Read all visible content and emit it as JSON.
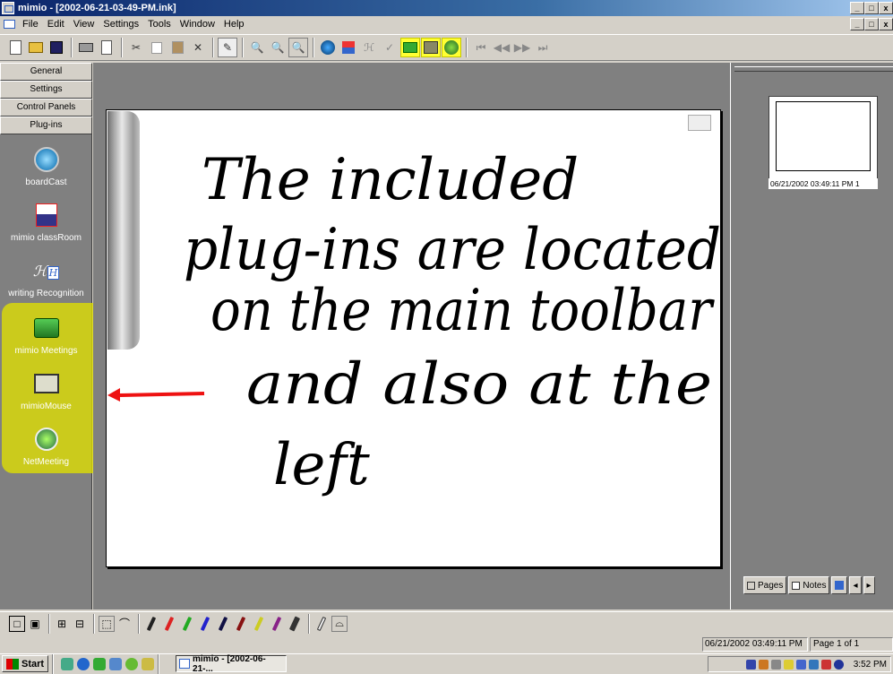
{
  "window": {
    "title": "mimio - [2002-06-21-03-49-PM.ink]",
    "controls": [
      "_",
      "□",
      "x"
    ]
  },
  "menu": [
    "File",
    "Edit",
    "View",
    "Settings",
    "Tools",
    "Window",
    "Help"
  ],
  "toolbar": {
    "icons": [
      "new-icon",
      "open-icon",
      "save-icon",
      "print-icon",
      "print-preview-icon",
      "cut-icon",
      "copy-icon",
      "paste-icon",
      "delete-icon",
      "pen-tool-icon",
      "zoom-in-icon",
      "zoom-out-icon",
      "zoom-fit-icon",
      "boardcast-icon",
      "classroom-icon",
      "handwriting-icon",
      "spellcheck-icon",
      "mimio-meetings-icon",
      "mimio-mouse-icon",
      "netmeeting-icon",
      "first-page-icon",
      "prev-page-icon",
      "next-page-icon",
      "last-page-icon"
    ],
    "highlight_color": "#ffff33"
  },
  "left_panel": {
    "buttons": [
      "General",
      "Settings",
      "Control Panels",
      "Plug-ins"
    ],
    "plugins": [
      {
        "label": "boardCast",
        "icon": "boardcast-icon"
      },
      {
        "label": "mimio classRoom",
        "icon": "classroom-icon"
      },
      {
        "label": "writing Recognition",
        "icon": "handwriting-recognition-icon"
      },
      {
        "label": "mimio Meetings",
        "icon": "meetings-icon"
      },
      {
        "label": "mimioMouse",
        "icon": "mouse-icon"
      },
      {
        "label": "NetMeeting",
        "icon": "netmeeting-icon"
      }
    ]
  },
  "board": {
    "handwriting": [
      "The included",
      "plug-ins are located",
      "on the main toolbar",
      "and also at the",
      "left"
    ],
    "arrow_color": "#ee1111"
  },
  "pages_panel": {
    "thumb_label": "06/21/2002 03:49:11 PM  1",
    "tabs": [
      "Pages",
      "Notes"
    ]
  },
  "status": {
    "date": "06/21/2002 03:49:11 PM",
    "page": "Page 1 of 1"
  },
  "taskbar": {
    "start": "Start",
    "task": "mimio - [2002-06-21-...",
    "clock": "3:52 PM"
  }
}
